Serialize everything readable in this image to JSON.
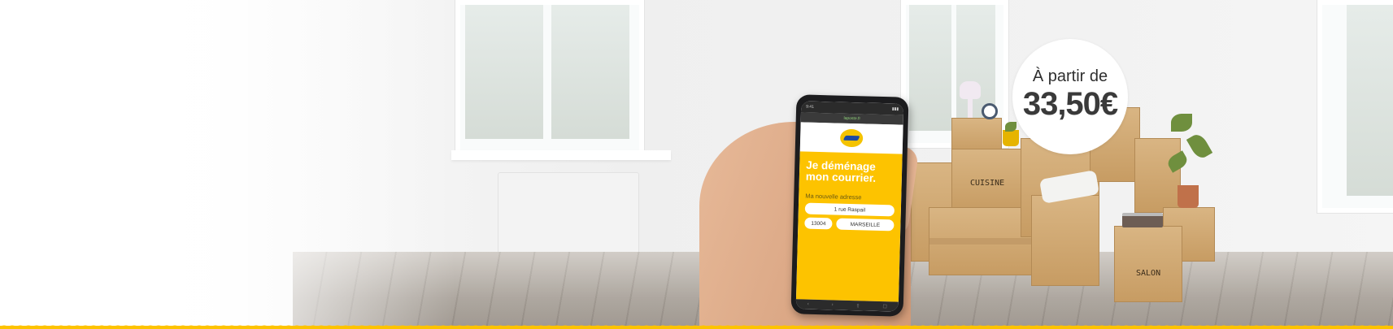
{
  "phone": {
    "url": "laposte.fr",
    "headline_line1": "Je déménage",
    "headline_line2": "mon courrier.",
    "address_label": "Ma nouvelle adresse",
    "street": "1 rue Raspail",
    "postcode": "13004",
    "city": "MARSEILLE"
  },
  "price": {
    "prefix": "À partir de",
    "value": "33,50€"
  },
  "boxes": {
    "label_cuisine": "CUISINE",
    "label_salon": "SALON"
  },
  "icons": {
    "logo": "la-poste-logo",
    "wave": "yellow-wave-border"
  },
  "colors": {
    "brand_yellow": "#fdc300",
    "brand_blue": "#1c4aa3",
    "text_dark": "#3a3a3a"
  }
}
